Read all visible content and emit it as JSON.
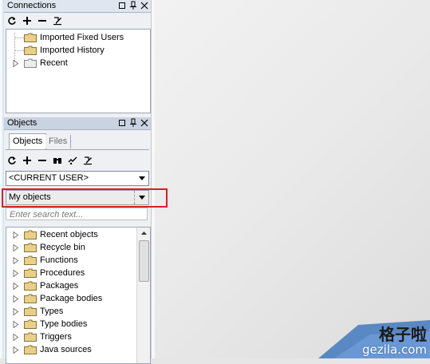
{
  "connections": {
    "title": "Connections",
    "items": [
      {
        "label": "Imported Fixed Users",
        "expandable": false
      },
      {
        "label": "Imported History",
        "expandable": false
      },
      {
        "label": "Recent",
        "expandable": true
      }
    ]
  },
  "objects": {
    "title": "Objects",
    "tabs": [
      {
        "label": "Objects",
        "active": true
      },
      {
        "label": "Files",
        "active": false
      }
    ],
    "user_select": "<CURRENT USER>",
    "filter_select": "My objects",
    "search_placeholder": "Enter search text...",
    "tree": [
      "Recent objects",
      "Recycle bin",
      "Functions",
      "Procedures",
      "Packages",
      "Package bodies",
      "Types",
      "Type bodies",
      "Triggers",
      "Java sources"
    ]
  },
  "watermark": {
    "cn": "格子啦",
    "url": "gezila.com"
  },
  "colors": {
    "highlight": "#d3222a",
    "folder": "#e8d08a",
    "titlebar": "#c9d3e2"
  },
  "icons": [
    "refresh-icon",
    "add-icon",
    "remove-icon",
    "edit-icon",
    "find-icon",
    "pin-icon",
    "restore-icon",
    "close-icon",
    "folder-icon",
    "expand-icon",
    "dropdown-arrow-icon"
  ]
}
